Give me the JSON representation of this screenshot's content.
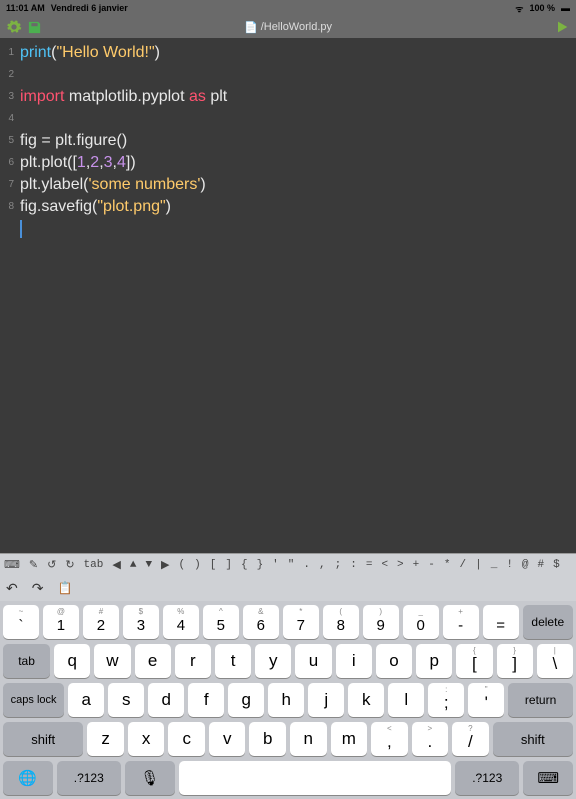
{
  "status": {
    "time": "11:01 AM",
    "date": "Vendredi 6 janvier",
    "wifi": "100 %",
    "signal": "᯾"
  },
  "toolbar": {
    "filename": "/HelloWorld.py"
  },
  "lines": [
    "1",
    "2",
    "3",
    "4",
    "5",
    "6",
    "7",
    "8"
  ],
  "code": {
    "l1a": "print",
    "l1b": "(",
    "l1c": "\"Hello World!\"",
    "l1d": ")",
    "l3a": "import",
    "l3b": " matplotlib.pyplot ",
    "l3c": "as",
    "l3d": " plt",
    "l5": "fig = plt.figure()",
    "l6a": "plt.plot([",
    "l6b": "1",
    "l6c": ",",
    "l6d": "2",
    "l6e": ",",
    "l6f": "3",
    "l6g": ",",
    "l6h": "4",
    "l6i": "])",
    "l7a": "plt.ylabel(",
    "l7b": "'some numbers'",
    "l7c": ")",
    "l8a": "fig.savefig(",
    "l8b": "\"plot.png\"",
    "l8c": ")"
  },
  "acc": [
    "↺",
    "↻",
    "tab",
    "◀",
    "▲",
    "▼",
    "▶",
    "(",
    ")",
    "[",
    "]",
    "{",
    "}",
    "'",
    "\"",
    ".",
    ",",
    ";",
    ":",
    "=",
    "<",
    ">",
    "+",
    "-",
    "*",
    "/",
    "|",
    "_",
    "!",
    "@",
    "#",
    "$"
  ],
  "acc2": {
    "undo": "↶",
    "redo": "↷",
    "paste": "📋"
  },
  "kb": {
    "numSub": [
      "~",
      "@",
      "#",
      "$",
      "%",
      "^",
      "&",
      "*",
      "(",
      ")",
      "_",
      "+"
    ],
    "numMain": [
      "`",
      "1",
      "2",
      "3",
      "4",
      "5",
      "6",
      "7",
      "8",
      "9",
      "0",
      "-",
      "="
    ],
    "delete": "delete",
    "tab": "tab",
    "row2Sub": [
      "",
      "",
      "",
      "",
      "",
      "",
      "",
      "",
      "",
      "",
      "{",
      "}",
      "|"
    ],
    "row2": [
      "q",
      "w",
      "e",
      "r",
      "t",
      "y",
      "u",
      "i",
      "o",
      "p",
      "[",
      "]",
      "\\"
    ],
    "caps": "caps lock",
    "return": "return",
    "row3Sub": [
      "",
      "",
      "",
      "",
      "",
      "",
      "",
      "",
      "",
      ":",
      "\""
    ],
    "row3": [
      "a",
      "s",
      "d",
      "f",
      "g",
      "h",
      "j",
      "k",
      "l",
      ";",
      "'"
    ],
    "shift": "shift",
    "row4Sub": [
      "",
      "",
      "",
      "",
      "",
      "",
      "",
      "<",
      ">",
      "?"
    ],
    "row4": [
      "z",
      "x",
      "c",
      "v",
      "b",
      "n",
      "m",
      ",",
      ".",
      "/"
    ],
    "globe": "🌐",
    "numkey": ".?123",
    "mic": "🎙"
  }
}
